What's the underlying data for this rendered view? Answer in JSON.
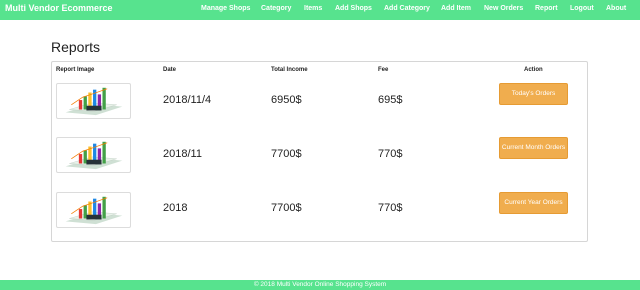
{
  "navbar": {
    "brand": "Multi Vendor Ecommerce",
    "items": [
      {
        "label": "Manage Shops"
      },
      {
        "label": "Category"
      },
      {
        "label": "Items"
      },
      {
        "label": "Add Shops"
      },
      {
        "label": "Add Category"
      },
      {
        "label": "Add Item"
      },
      {
        "label": "New Orders"
      },
      {
        "label": "Report"
      },
      {
        "label": "Logout"
      },
      {
        "label": "About"
      }
    ],
    "color": "#57e38e"
  },
  "page": {
    "title": "Reports"
  },
  "table": {
    "headers": {
      "image": "Report Image",
      "date": "Date",
      "income": "Total Income",
      "fee": "Fee",
      "action": "Action"
    },
    "rows": [
      {
        "thumb_icon": "bar-chart-report-icon",
        "date": "2018/11/4",
        "income": "6950$",
        "fee": "695$",
        "action_label": "Today's Orders"
      },
      {
        "thumb_icon": "bar-chart-report-icon",
        "date": "2018/11",
        "income": "7700$",
        "fee": "770$",
        "action_label": "Current Month Orders"
      },
      {
        "thumb_icon": "bar-chart-report-icon",
        "date": "2018",
        "income": "7700$",
        "fee": "770$",
        "action_label": "Current Year Orders"
      }
    ],
    "button_color": "#f0ad4e"
  },
  "footer": {
    "text": "© 2018 Multi Vendor Online Shopping System"
  }
}
